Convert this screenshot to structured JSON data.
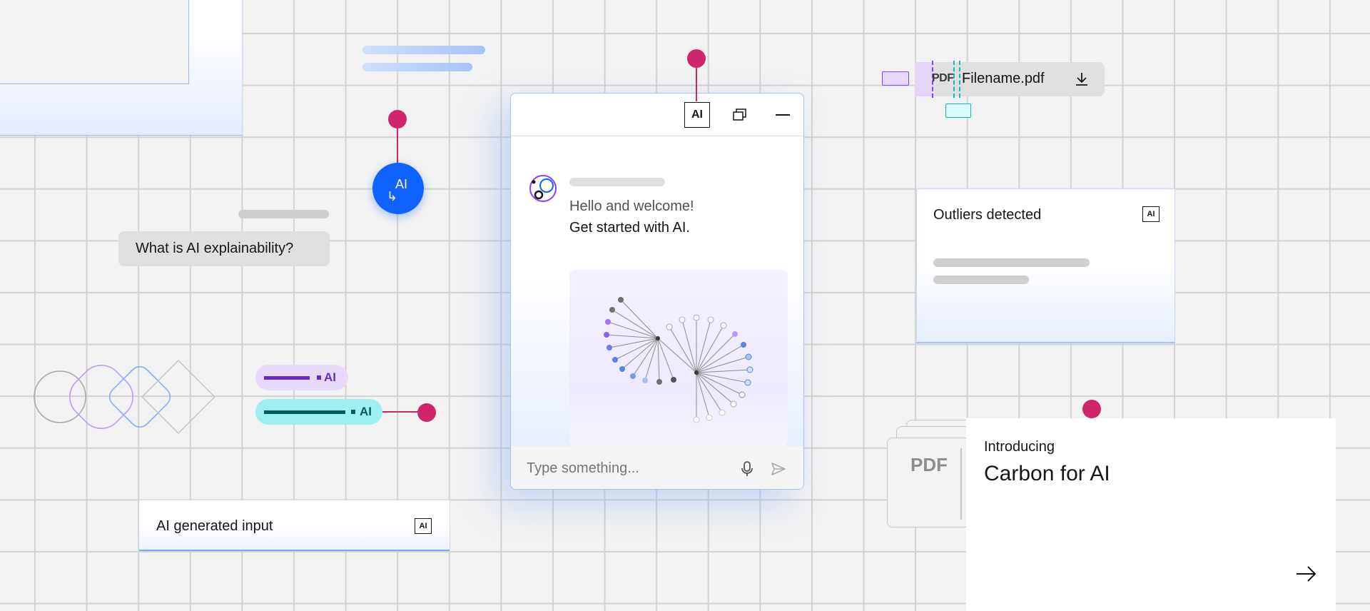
{
  "question_bubble": {
    "text": "What is AI explainability?"
  },
  "ai_button": {
    "label": "AI"
  },
  "tags": [
    {
      "label": "AI",
      "color": "#6929c4",
      "bg": "#e8daff"
    },
    {
      "label": "AI",
      "color": "#005d5d",
      "bg": "#9ef0f0"
    }
  ],
  "chat": {
    "header": {
      "ai_badge": "AI"
    },
    "greeting_line1": "Hello and welcome!",
    "greeting_line2": "Get started with AI.",
    "input_placeholder": "Type something..."
  },
  "file_chip": {
    "badge": "PDF",
    "filename": "Filename.pdf"
  },
  "outliers_card": {
    "title": "Outliers detected",
    "ai_badge": "AI"
  },
  "ai_input": {
    "label": "AI generated input",
    "ai_badge": "AI"
  },
  "pdf_stack": {
    "label": "PDF"
  },
  "promo_card": {
    "eyebrow": "Introducing",
    "title": "Carbon for AI"
  },
  "colors": {
    "accent": "#0f62fe",
    "pin": "#d0246b",
    "purple": "#8a3ffc",
    "teal": "#08bdba"
  }
}
